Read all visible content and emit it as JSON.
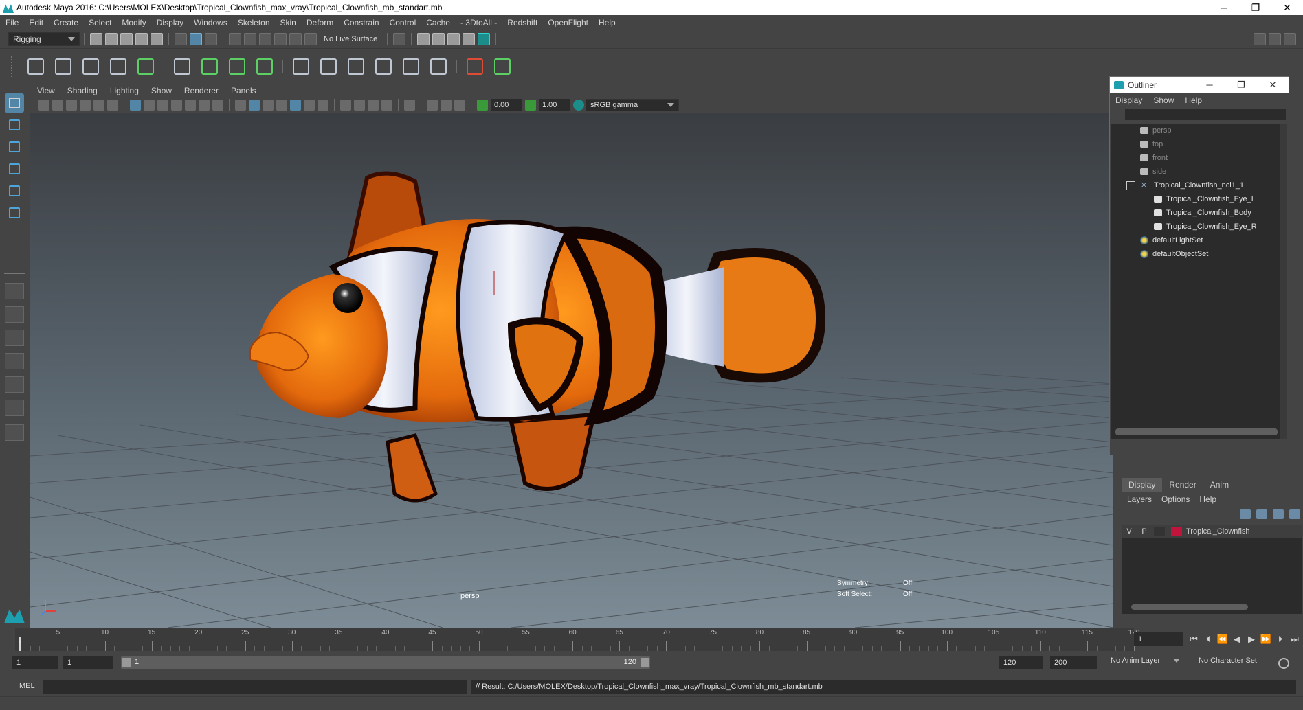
{
  "window": {
    "title": "Autodesk Maya 2016: C:\\Users\\MOLEX\\Desktop\\Tropical_Clownfish_max_vray\\Tropical_Clownfish_mb_standart.mb",
    "minimize": "─",
    "restore": "❐",
    "close": "✕"
  },
  "menubar": [
    "File",
    "Edit",
    "Create",
    "Select",
    "Modify",
    "Display",
    "Windows",
    "Skeleton",
    "Skin",
    "Deform",
    "Constrain",
    "Control",
    "Cache",
    "- 3DtoAll -",
    "Redshift",
    "OpenFlight",
    "Help"
  ],
  "statusline": {
    "menuset": "Rigging",
    "live_surface": "No Live Surface"
  },
  "viewport": {
    "menus": [
      "View",
      "Shading",
      "Lighting",
      "Show",
      "Renderer",
      "Panels"
    ],
    "near_value": "0.00",
    "far_value": "1.00",
    "color_space": "sRGB gamma",
    "camera_label": "persp",
    "symmetry_label": "Symmetry:",
    "symmetry_value": "Off",
    "soft_select_label": "Soft Select:",
    "soft_select_value": "Off"
  },
  "outliner": {
    "title": "Outliner",
    "menus": [
      "Display",
      "Show",
      "Help"
    ],
    "items": [
      {
        "label": "persp",
        "icon": "camera-icon",
        "dim": true
      },
      {
        "label": "top",
        "icon": "camera-icon",
        "dim": true
      },
      {
        "label": "front",
        "icon": "camera-icon",
        "dim": true
      },
      {
        "label": "side",
        "icon": "camera-icon",
        "dim": true
      },
      {
        "label": "Tropical_Clownfish_ncl1_1",
        "icon": "group-icon",
        "dim": false
      },
      {
        "label": "Tropical_Clownfish_Eye_L",
        "icon": "mesh-icon",
        "dim": false
      },
      {
        "label": "Tropical_Clownfish_Body",
        "icon": "mesh-icon",
        "dim": false
      },
      {
        "label": "Tropical_Clownfish_Eye_R",
        "icon": "mesh-icon",
        "dim": false
      },
      {
        "label": "defaultLightSet",
        "icon": "set-icon",
        "dim": false
      },
      {
        "label": "defaultObjectSet",
        "icon": "set-icon",
        "dim": false
      }
    ],
    "collapse_symbol": "−"
  },
  "layer_editor": {
    "tabs": [
      "Display",
      "Render",
      "Anim"
    ],
    "menus": [
      "Layers",
      "Options",
      "Help"
    ],
    "layer": {
      "visible": "V",
      "playback": "P",
      "name": "Tropical_Clownfish",
      "color": "#c0143c"
    }
  },
  "timeline": {
    "ticks": [
      "5",
      "10",
      "15",
      "20",
      "25",
      "30",
      "35",
      "40",
      "45",
      "50",
      "55",
      "60",
      "65",
      "70",
      "75",
      "80",
      "85",
      "90",
      "95",
      "100",
      "105",
      "110",
      "115",
      "120"
    ],
    "first_label": "1",
    "current_frame": "1"
  },
  "range": {
    "start": "1",
    "playback_start": "1",
    "bar_start": "1",
    "bar_end": "120",
    "playback_end": "120",
    "end": "200",
    "anim_layer": "No Anim Layer",
    "character_set": "No Character Set"
  },
  "cmdline": {
    "label": "MEL",
    "result": "// Result: C:/Users/MOLEX/Desktop/Tropical_Clownfish_max_vray/Tropical_Clownfish_mb_standart.mb"
  }
}
